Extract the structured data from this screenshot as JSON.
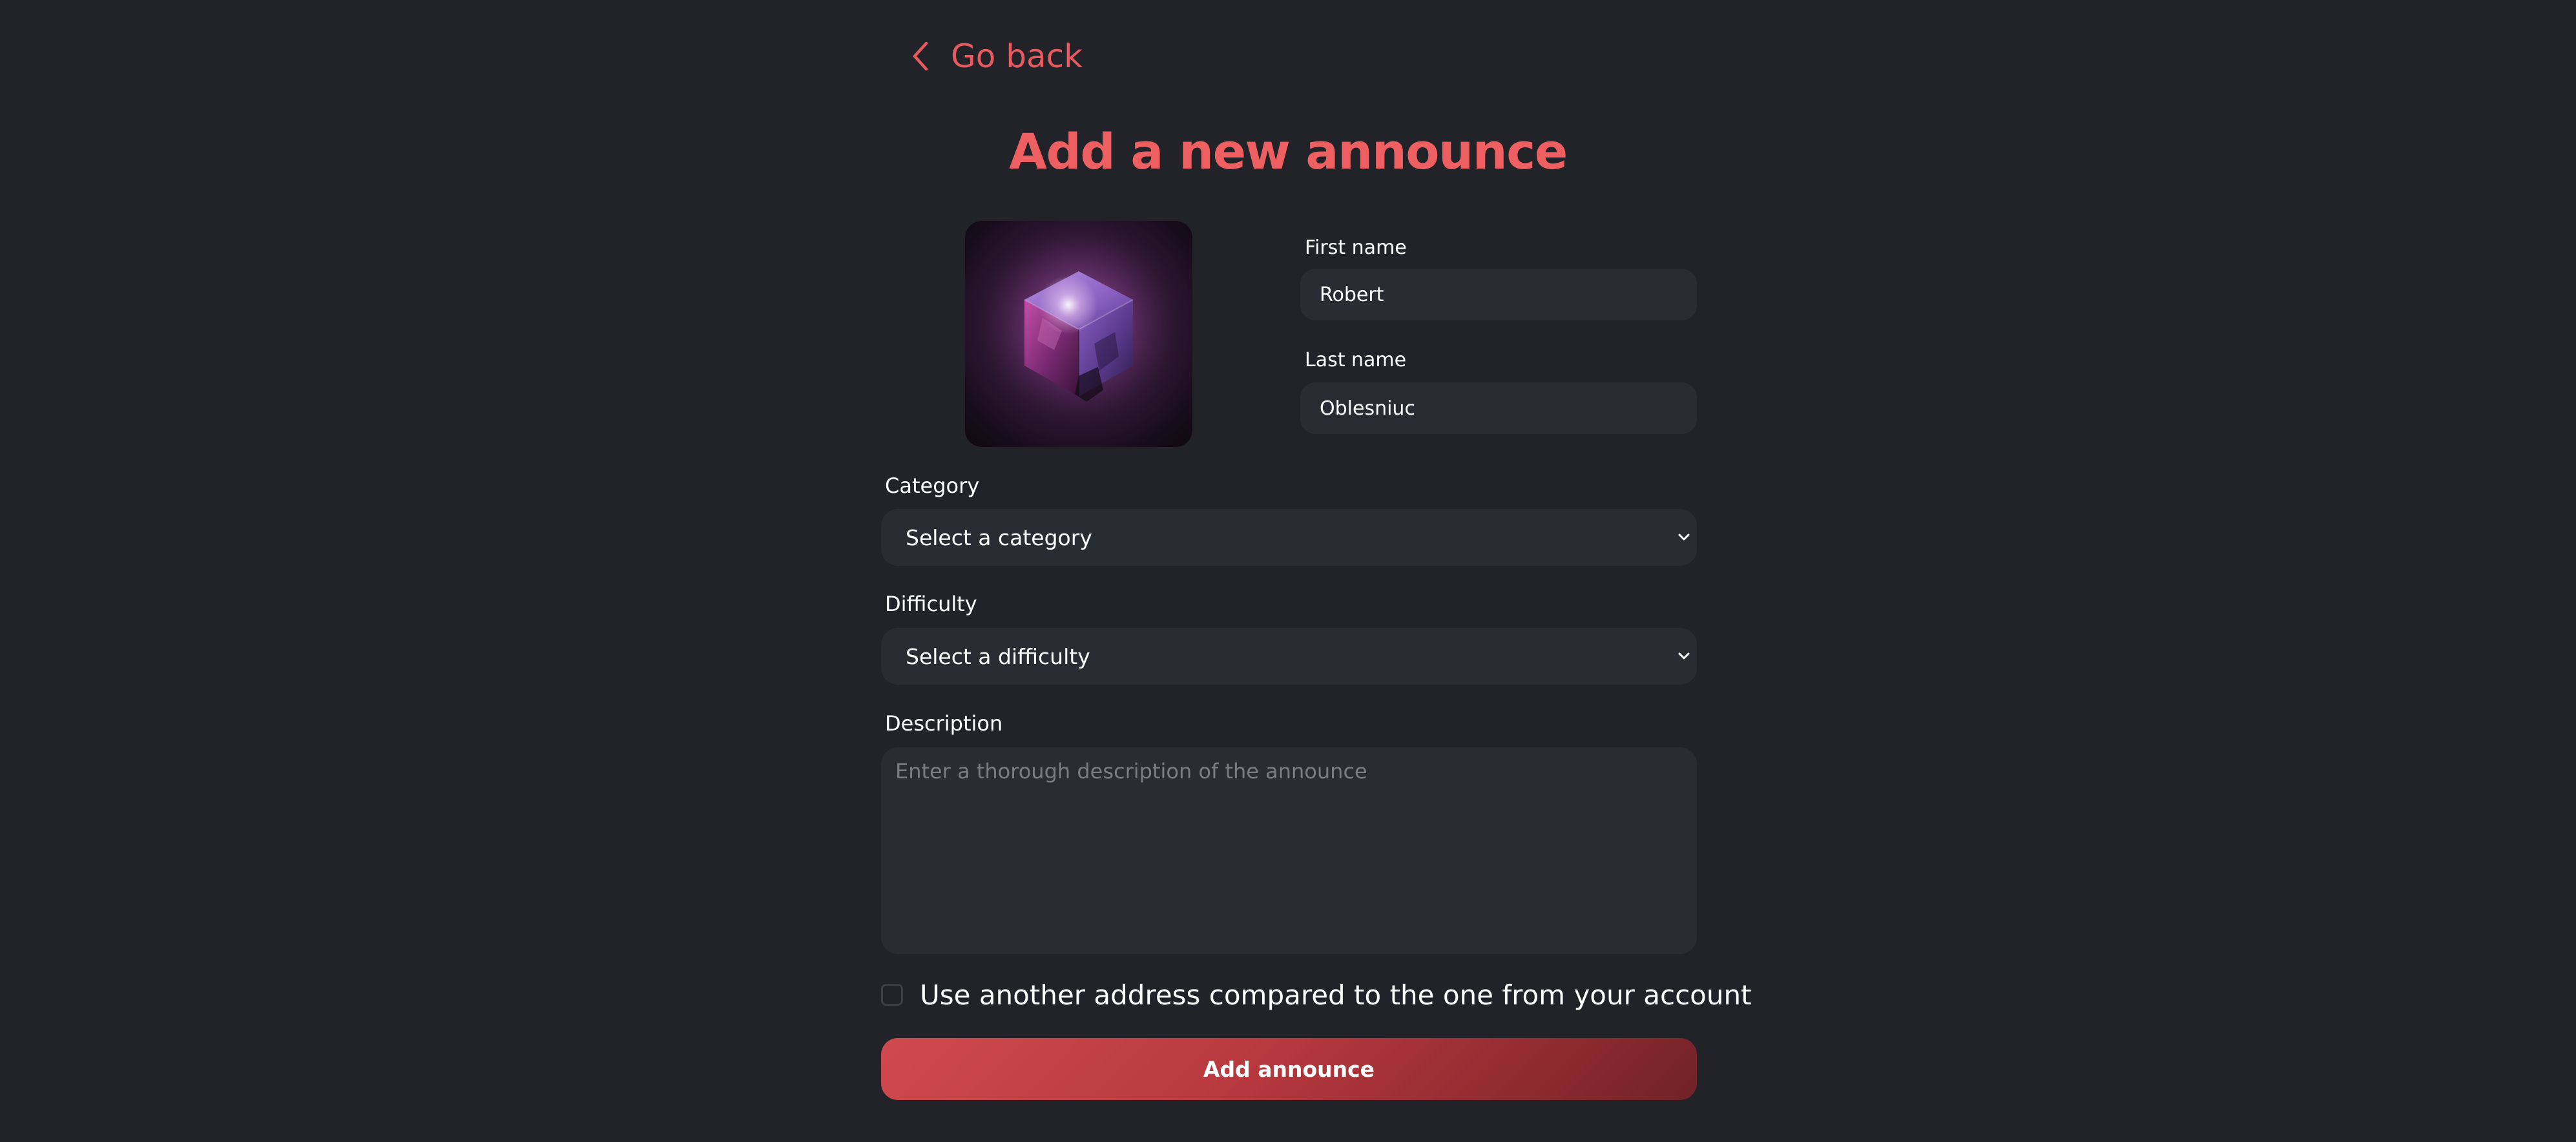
{
  "nav": {
    "back_label": "Go back",
    "back_icon": "chevron-left-icon"
  },
  "page": {
    "title": "Add a new announce"
  },
  "image": {
    "icon": "crystal-cube-image"
  },
  "form": {
    "first_name": {
      "label": "First name",
      "value": "Robert"
    },
    "last_name": {
      "label": "Last name",
      "value": "Oblesniuc"
    },
    "category": {
      "label": "Category",
      "value": "Select a category",
      "icon": "chevron-down-icon"
    },
    "difficulty": {
      "label": "Difficulty",
      "value": "Select a difficulty",
      "icon": "chevron-down-icon"
    },
    "description": {
      "label": "Description",
      "placeholder": "Enter a thorough description of the announce",
      "value": ""
    },
    "alt_address": {
      "label": "Use another address compared to the one from your account",
      "checked": false
    },
    "submit_label": "Add announce"
  },
  "colors": {
    "background": "#212329",
    "accent": "#ee5f61",
    "input_bg": "#2a2c33",
    "button_start": "#cf4a4f",
    "button_end": "#6f2226"
  }
}
